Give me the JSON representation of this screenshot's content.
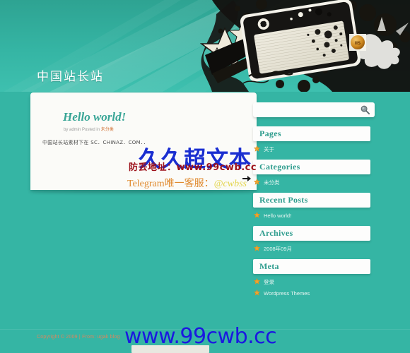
{
  "site": {
    "title": "中国站长站",
    "background_color": "#35b5a4",
    "accent_color": "#2f9d8e"
  },
  "header": {
    "art_name": "grunge-radio-stars-illustration"
  },
  "post": {
    "title": "Hello world!",
    "meta_prefix": "by admin Posted in ",
    "meta_category": "未分类",
    "body": "中国站长站素材下在 SC．CHINAZ．COM．．"
  },
  "search": {
    "placeholder": "",
    "value": "",
    "icon": "search-icon"
  },
  "widgets": [
    {
      "title": "Pages",
      "items": [
        "关于"
      ]
    },
    {
      "title": "Categories",
      "items": [
        "未分类"
      ]
    },
    {
      "title": "Recent Posts",
      "items": [
        "Hello world!"
      ]
    },
    {
      "title": "Archives",
      "items": [
        "2008年09月"
      ]
    },
    {
      "title": "Meta",
      "items": [
        "登录",
        "Wordpress Themes"
      ]
    }
  ],
  "footer": {
    "text": "Copyright © 2009 | From: ugak blog"
  },
  "watermarks": {
    "main": "久久超文本",
    "address": "防丢地址：www.99cwb.cc",
    "telegram_label": "Telegram唯一客服：",
    "telegram_handle": "@cwbss",
    "bottom": "www.99cwb.cc"
  }
}
